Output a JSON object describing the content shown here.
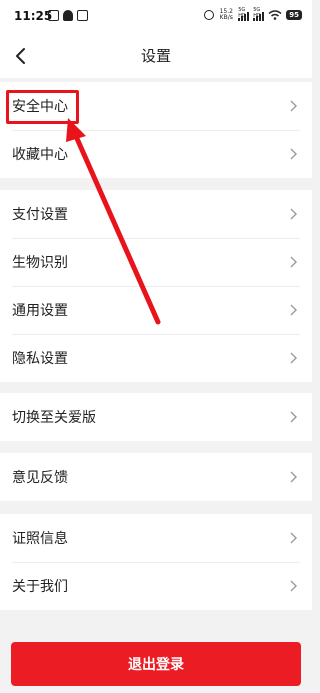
{
  "status_bar": {
    "time": "11:25",
    "net_speed_value": "15.2",
    "net_speed_unit": "KB/s",
    "sim1_label": "5G HD",
    "sim2_label": "5G HD",
    "battery": "95"
  },
  "header": {
    "title": "设置"
  },
  "groups": [
    {
      "items": [
        {
          "label": "安全中心"
        },
        {
          "label": "收藏中心"
        }
      ]
    },
    {
      "items": [
        {
          "label": "支付设置"
        },
        {
          "label": "生物识别"
        },
        {
          "label": "通用设置"
        },
        {
          "label": "隐私设置"
        }
      ]
    },
    {
      "items": [
        {
          "label": "切换至关爱版"
        }
      ]
    },
    {
      "items": [
        {
          "label": "意见反馈"
        }
      ]
    },
    {
      "items": [
        {
          "label": "证照信息"
        },
        {
          "label": "关于我们"
        }
      ]
    }
  ],
  "footer": {
    "logout_label": "退出登录"
  },
  "colors": {
    "accent": "#ec1c24",
    "annotation": "#e8131b",
    "background": "#f2f2f2"
  }
}
